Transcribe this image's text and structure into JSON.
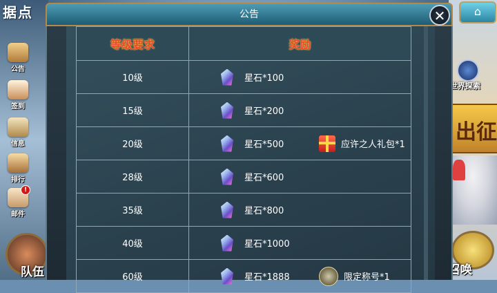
{
  "hud": {
    "title": "据点",
    "side_menu": [
      {
        "label": "公告",
        "icon": "megaphone-icon"
      },
      {
        "label": "签到",
        "icon": "calendar-icon"
      },
      {
        "label": "信息",
        "icon": "scroll-icon"
      },
      {
        "label": "排行",
        "icon": "ranking-scroll-icon"
      },
      {
        "label": "邮件",
        "icon": "mail-icon",
        "badge": "!"
      }
    ],
    "team_label": "队伍",
    "world_explore_label": "世界探索",
    "expedition_label": "出征",
    "summon_label": "召唤",
    "home_icon": "⌂"
  },
  "dialog": {
    "title": "公告",
    "close_symbol": "✕",
    "header_level": "等级要求",
    "header_reward": "奖励",
    "rows": [
      {
        "level": "10级",
        "reward1": "星石*100",
        "reward2": "",
        "reward2_icon": ""
      },
      {
        "level": "15级",
        "reward1": "星石*200",
        "reward2": "",
        "reward2_icon": ""
      },
      {
        "level": "20级",
        "reward1": "星石*500",
        "reward2": "应许之人礼包*1",
        "reward2_icon": "gift-icon"
      },
      {
        "level": "28级",
        "reward1": "星石*600",
        "reward2": "",
        "reward2_icon": ""
      },
      {
        "level": "35级",
        "reward1": "星石*800",
        "reward2": "",
        "reward2_icon": ""
      },
      {
        "level": "40级",
        "reward1": "星石*1000",
        "reward2": "",
        "reward2_icon": ""
      },
      {
        "level": "60级",
        "reward1": "星石*1888",
        "reward2": "限定称号*1",
        "reward2_icon": "title-badge-icon"
      }
    ]
  },
  "colors": {
    "header_text": "#e84a2a",
    "dialog_header": "#1e5c74",
    "frame_gold": "#b58a48"
  }
}
